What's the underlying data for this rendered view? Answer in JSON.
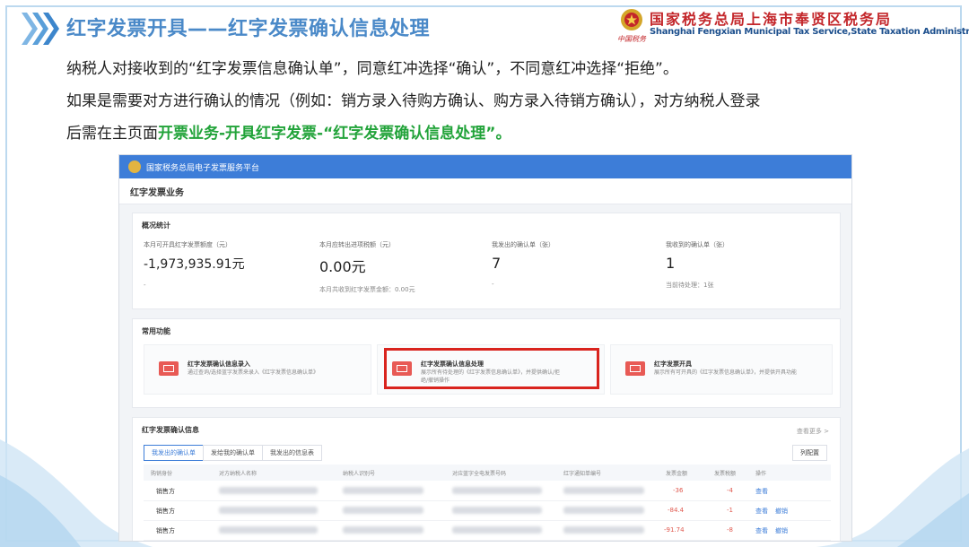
{
  "slide": {
    "title": "红字发票开具——红字发票确认信息处理",
    "org_cn": "国家税务总局上海市奉贤区税务局",
    "org_en": "Shanghai Fengxian Municipal Tax Service,State Taxation Administration",
    "org_script": "中国税务",
    "line1": "纳税人对接收到的“红字发票信息确认单”，同意红冲选择“确认”，不同意红冲选择“拒绝”。",
    "line2": "如果是需要对方进行确认的情况（例如：销方录入待购方确认、购方录入待销方确认），对方纳税人登录",
    "line3_prefix": "后需在主页面",
    "line3_highlight": "开票业务-开具红字发票-“红字发票确认信息处理”。",
    "colors": {
      "title": "#4a89c8",
      "highlight_text": "#22a33a",
      "org_cn": "#c3262a",
      "org_en": "#1c4f8d"
    }
  },
  "screenshot": {
    "platform_title": "国家税务总局电子发票服务平台",
    "page_title": "红字发票业务",
    "overview": {
      "title": "概况统计",
      "stats": [
        {
          "label": "本月可开具红字发票额度（元）",
          "value": "-1,973,935.91元",
          "sub": "-"
        },
        {
          "label": "本月应转出进项税额（元）",
          "value": "0.00元",
          "sub": "本月共收到红字发票金额：0.00元"
        },
        {
          "label": "我发出的确认单（张）",
          "value": "7",
          "sub": "-"
        },
        {
          "label": "我收到的确认单（张）",
          "value": "1",
          "sub": "当前待处理：1张"
        }
      ]
    },
    "functions": {
      "title": "常用功能",
      "items": [
        {
          "name": "红字发票确认信息录入",
          "desc": "通过查询/选择蓝字发票来录入《红字发票信息确认单》"
        },
        {
          "name": "红字发票确认信息处理",
          "desc": "展示所有待处理的《红字发票信息确认单》，并提供确认/拒绝/撤销操作"
        },
        {
          "name": "红字发票开具",
          "desc": "展示所有可开具的《红字发票信息确认单》，并提供开具功能"
        }
      ]
    },
    "confirm_info": {
      "title": "红字发票确认信息",
      "view_more": "查看更多 >",
      "tabs": [
        "我发出的确认单",
        "发给我的确认单",
        "我发出的信息表"
      ],
      "column_button": "列配置",
      "columns": [
        "购销身份",
        "对方纳税人名称",
        "纳税人识别号",
        "对应蓝字全电发票号码",
        "红字通知单编号",
        "发票金额",
        "发票税额",
        "操作"
      ],
      "rows": [
        {
          "role": "销售方",
          "amount": "-36",
          "tax": "-4",
          "actions": [
            "查看"
          ]
        },
        {
          "role": "销售方",
          "amount": "-84.4",
          "tax": "-1",
          "actions": [
            "查看",
            "撤销"
          ]
        },
        {
          "role": "销售方",
          "amount": "-91.74",
          "tax": "-8",
          "actions": [
            "查看",
            "撤销"
          ]
        }
      ]
    }
  }
}
